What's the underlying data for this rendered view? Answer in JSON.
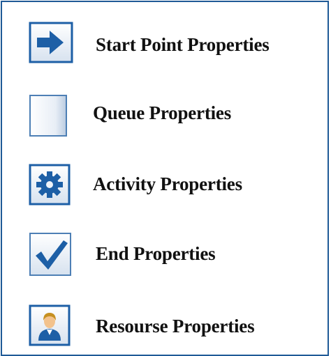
{
  "legend": {
    "items": [
      {
        "id": "start",
        "label": "Start Point Properties",
        "icon": "arrow-right-icon"
      },
      {
        "id": "queue",
        "label": "Queue Properties",
        "icon": "queue-box-icon"
      },
      {
        "id": "activity",
        "label": "Activity Properties",
        "icon": "gear-icon"
      },
      {
        "id": "end",
        "label": "End Properties",
        "icon": "checkmark-icon"
      },
      {
        "id": "resource",
        "label": "Resourse Properties",
        "icon": "person-icon"
      }
    ]
  },
  "colors": {
    "border": "#1f5a96",
    "icon_blue": "#1d5fa6",
    "icon_light": "#dfe8f3"
  }
}
